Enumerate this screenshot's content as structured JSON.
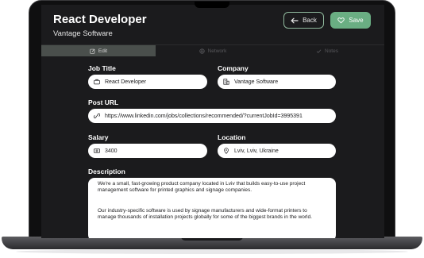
{
  "header": {
    "title": "React Developer",
    "company": "Vantage Software",
    "back_label": "Back",
    "save_label": "Save"
  },
  "tabs": [
    {
      "label": "Edit",
      "active": true
    },
    {
      "label": "Network",
      "active": false
    },
    {
      "label": "Notes",
      "active": false
    }
  ],
  "form": {
    "job_title": {
      "label": "Job Title",
      "value": "React Developer"
    },
    "company": {
      "label": "Company",
      "value": "Vantage Software"
    },
    "post_url": {
      "label": "Post URL",
      "value": "https://www.linkedin.com/jobs/collections/recommended/?currentJobId=3995391"
    },
    "salary": {
      "label": "Salary",
      "value": "3400"
    },
    "location": {
      "label": "Location",
      "value": "Lviv, Lviv, Ukraine"
    },
    "description": {
      "label": "Description",
      "paragraphs": [
        "We're a small, fast-growing product company located in Lviv that builds easy-to-use project management software for printed graphics and signage companies.",
        "Our industry-specific software is used by signage manufacturers and wide-format printers to manage thousands of installation projects globally for some of the biggest brands in the world."
      ]
    }
  },
  "colors": {
    "screen_bg": "#1b1b1d",
    "accent": "#6aae83",
    "active_tab": "#4a4f4c"
  }
}
